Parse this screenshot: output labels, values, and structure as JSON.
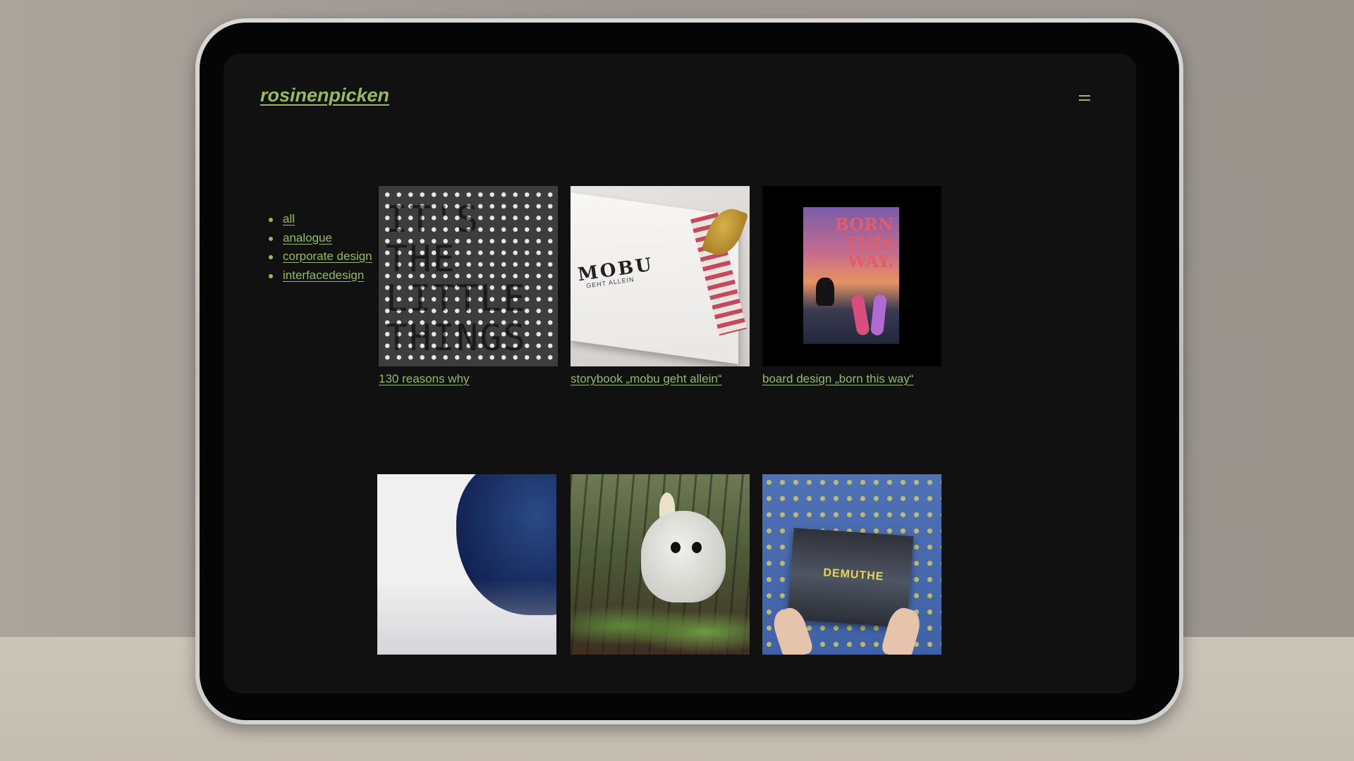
{
  "site": {
    "logo": "rosinenpicken",
    "menu_icon": "hamburger-menu-icon"
  },
  "filters": [
    {
      "label": "all"
    },
    {
      "label": "analogue"
    },
    {
      "label": "corporate design"
    },
    {
      "label": "interfacedesign"
    }
  ],
  "projects": [
    {
      "caption": "130 reasons why",
      "thumb_text": "IT'S\nTHE\nLITTLE\nTHINGS"
    },
    {
      "caption": "storybook „mobu geht allein“",
      "thumb_title": "MOBU",
      "thumb_subtitle": "GEHT ALLEIN"
    },
    {
      "caption": "board design „born this way“",
      "thumb_title": "BORN\nTHIS\nWAY."
    },
    {
      "caption": ""
    },
    {
      "caption": ""
    },
    {
      "caption": "",
      "thumb_title": "DEMUTHE"
    }
  ],
  "colors": {
    "accent": "#98b95e",
    "screen_background": "#111111"
  }
}
